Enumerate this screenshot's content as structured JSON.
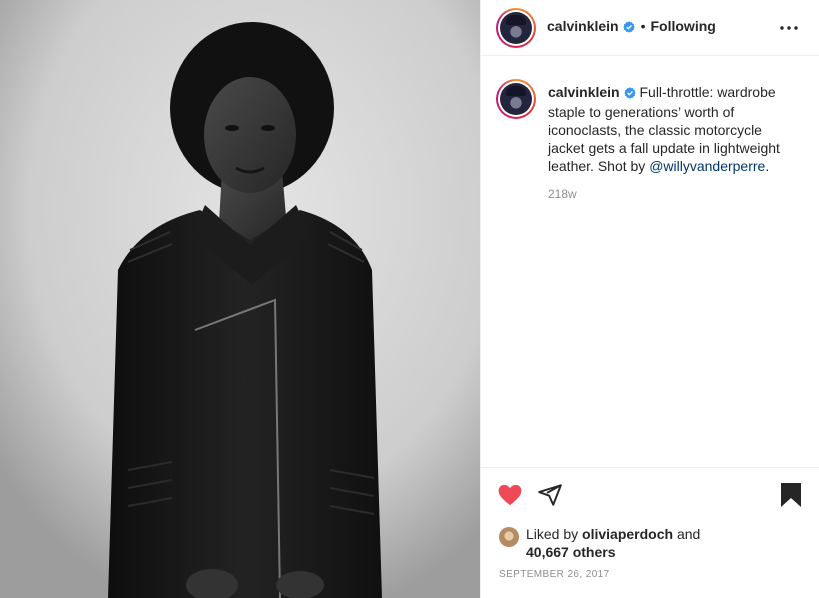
{
  "post": {
    "image_alt": "Black and white portrait of a model in a black leather motorcycle jacket"
  },
  "header": {
    "username": "calvinklein",
    "separator": "•",
    "follow_status": "Following",
    "more_icon": "more-dots-icon"
  },
  "caption": {
    "username": "calvinklein",
    "text": "Full-throttle: wardrobe staple to generations’ worth of iconoclasts, the classic motorcycle jacket gets a fall update in lightweight leather. Shot by ",
    "mention": "@willyvanderperre",
    "text_end": ".",
    "time_ago": "218w"
  },
  "actions": {
    "like_icon": "heart-icon",
    "share_icon": "share-icon",
    "save_icon": "bookmark-icon",
    "like_color": "#ed4956"
  },
  "likes": {
    "prefix": "Liked by ",
    "liker": "oliviaperdoch",
    "middle": " and",
    "count": "40,667 others"
  },
  "date": "SEPTEMBER 26, 2017",
  "colors": {
    "text": "#262626",
    "secondary": "#8e8e8e",
    "link": "#00376b",
    "verified": "#3897f0",
    "border": "#efefef"
  }
}
